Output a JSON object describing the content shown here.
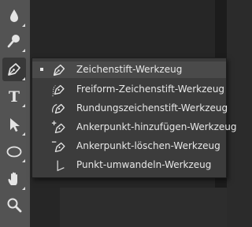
{
  "toolbar": {
    "tools": [
      {
        "icon": "blur-drop-icon"
      },
      {
        "icon": "dodge-icon"
      },
      {
        "icon": "pen-icon",
        "active": true
      },
      {
        "icon": "type-icon",
        "glyph": "T"
      },
      {
        "icon": "path-selection-icon"
      },
      {
        "icon": "ellipse-icon"
      },
      {
        "icon": "hand-icon"
      },
      {
        "icon": "zoom-icon"
      }
    ]
  },
  "flyout": {
    "items": [
      {
        "label": "Zeichenstift-Werkzeug",
        "icon": "pen-icon",
        "selected": true
      },
      {
        "label": "Freiform-Zeichenstift-Werkzeug",
        "icon": "freeform-pen-icon"
      },
      {
        "label": "Rundungszeichenstift-Werkzeug",
        "icon": "curvature-pen-icon"
      },
      {
        "label": "Ankerpunkt-hinzufügen-Werkzeug",
        "icon": "add-anchor-point-icon"
      },
      {
        "label": "Ankerpunkt-löschen-Werkzeug",
        "icon": "delete-anchor-point-icon"
      },
      {
        "label": "Punkt-umwandeln-Werkzeug",
        "icon": "convert-point-icon"
      }
    ]
  }
}
